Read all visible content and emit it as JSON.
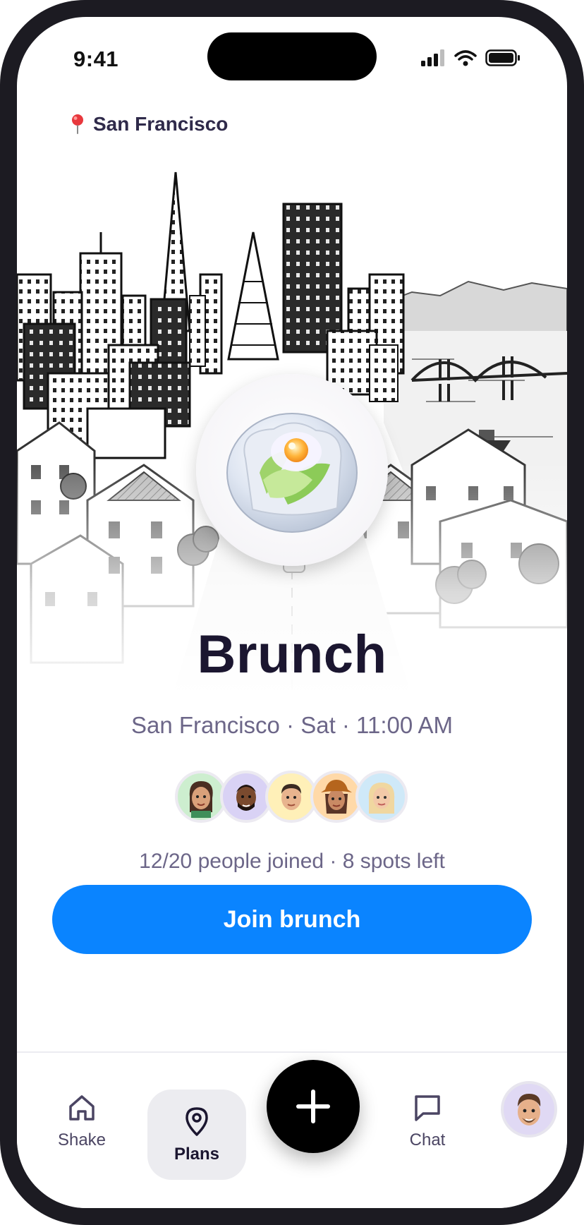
{
  "status_bar": {
    "time": "9:41"
  },
  "location": {
    "label": "San Francisco"
  },
  "event": {
    "title": "Brunch",
    "subtitle": "San Francisco · Sat · 11:00 AM",
    "joined_text": "12/20 people joined · 8 spots left",
    "attendee_avatar_colors": [
      "#cdeecf",
      "#d9d2f5",
      "#fff0b8",
      "#ffd9a8",
      "#cfe9f8"
    ]
  },
  "actions": {
    "join_label": "Join brunch"
  },
  "tabs": [
    {
      "label": "Shake",
      "icon": "home-icon"
    },
    {
      "label": "Plans",
      "icon": "map-pin-icon"
    },
    {
      "label": "Chat",
      "icon": "chat-bubble-icon"
    }
  ],
  "colors": {
    "accent": "#0a84ff",
    "text_dark": "#1b1630",
    "text_muted": "#6c6688"
  }
}
